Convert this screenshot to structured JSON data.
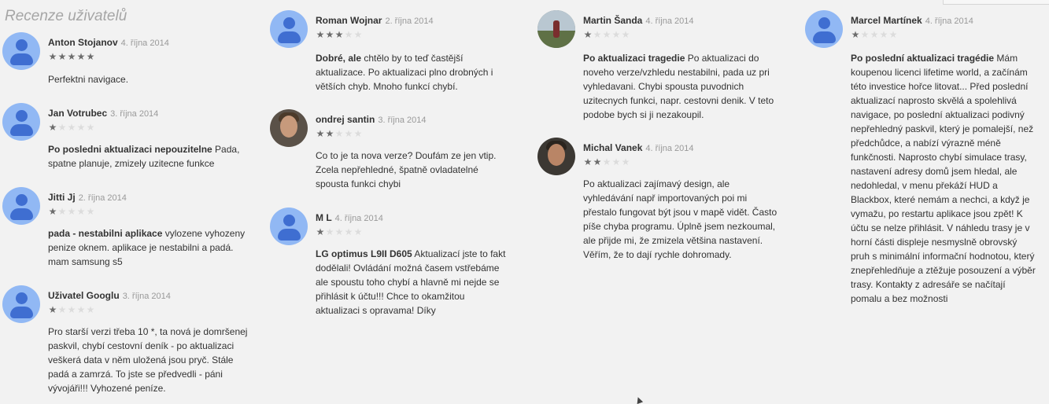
{
  "section_title": "Recenze uživatelů",
  "reviews": [
    {
      "author": "Anton Stojanov",
      "date": "4. října 2014",
      "rating": 5,
      "title": "",
      "body": "Perfektni navigace."
    },
    {
      "author": "Jan Votrubec",
      "date": "3. října 2014",
      "rating": 1,
      "title": "Po posledni aktualizaci nepouzitelne",
      "body": " Pada, spatne planuje, zmizely uzitecne funkce"
    },
    {
      "author": "Jitti Jj",
      "date": "2. října 2014",
      "rating": 1,
      "title": "pada - nestabilni aplikace",
      "body": " vylozene vyhozeny penize oknem. aplikace je nestabilni a padá. mam samsung s5"
    },
    {
      "author": "Uživatel Googlu",
      "date": "3. října 2014",
      "rating": 1,
      "title": "",
      "body": "Pro starší verzi třeba 10 *, ta nová je domršenej paskvil, chybí cestovní deník - po aktualizaci veškerá data v něm uložená jsou pryč. Stále padá a zamrzá. To jste se předvedli - páni vývojáři!!! Vyhozené peníze."
    },
    {
      "author": "Roman Wojnar",
      "date": "2. října 2014",
      "rating": 3,
      "title": "Dobré, ale",
      "body": " chtělo by to teď častější aktualizace. Po aktualizaci plno drobných i větších chyb. Mnoho funkcí chybí."
    },
    {
      "author": "ondrej santin",
      "date": "3. října 2014",
      "rating": 2,
      "title": "",
      "body": "Co to je ta nova verze? Doufám ze jen vtip. Zcela nepřehledné, špatně ovladatelné spousta funkci chybi"
    },
    {
      "author": "M L",
      "date": "4. října 2014",
      "rating": 1,
      "title": "LG optimus L9II D605",
      "body": " Aktualizací jste to fakt dodělali! Ovládání možná časem vstřebáme ale spoustu toho chybí a hlavně mi nejde se přihlásit k účtu!!! Chce to okamžitou aktualizaci s opravama! Díky"
    },
    {
      "author": "Martin Šanda",
      "date": "4. října 2014",
      "rating": 1,
      "title": "Po aktualizaci tragedie",
      "body": " Po aktualizaci do noveho verze/vzhledu nestabilni, pada uz pri vyhledavani. Chybi spousta puvodnich uzitecnych funkci, napr. cestovni denik. V teto podobe bych si ji nezakoupil."
    },
    {
      "author": "Michal Vanek",
      "date": "4. října 2014",
      "rating": 2,
      "title": "",
      "body": "Po aktualizaci zajímavý design, ale vyhledávání např importovaných poi mi přestalo fungovat být jsou v mapě vidět. Často píše chyba programu. Úplně jsem nezkoumal, ale přijde mi, že zmizela většina nastavení. Věřím, že to dají rychle dohromady."
    },
    {
      "author": "Marcel Martínek",
      "date": "4. října 2014",
      "rating": 1,
      "title": "Po poslední aktualizaci tragédie",
      "body": " Mám koupenou licenci lifetime world, a začínám této investice hořce litovat... Před poslední aktualizací naprosto skvělá a spolehlivá navigace, po poslední aktualizaci podivný nepřehledný paskvil, který je pomalejší, než předchůdce, a nabízí výrazně méně funkčnosti. Naprosto chybí simulace trasy, nastavení adresy domů jsem hledal, ale nedohledal, v menu překáží HUD a Blackbox, které nemám a nechci, a když je vymažu, po restartu aplikace jsou zpět! K účtu se nelze přihlásit. V náhledu trasy je v horní části displeje nesmyslně obrovský pruh s minimální informační hodnotou, který znepřehledňuje a ztěžuje posouzení a výběr trasy. Kontakty z adresáře se načítají pomalu a bez možnosti"
    }
  ],
  "icons": {
    "avatar": "person-avatar-icon",
    "star": "star-icon"
  },
  "colors": {
    "background": "#f2f2f2",
    "star_on": "#6d6d6d",
    "star_off": "#dcdcdc",
    "avatar": "#91b8f4",
    "avatar_figure": "#3f6ed1",
    "date": "#999999",
    "section_title": "#a6a6a6"
  }
}
